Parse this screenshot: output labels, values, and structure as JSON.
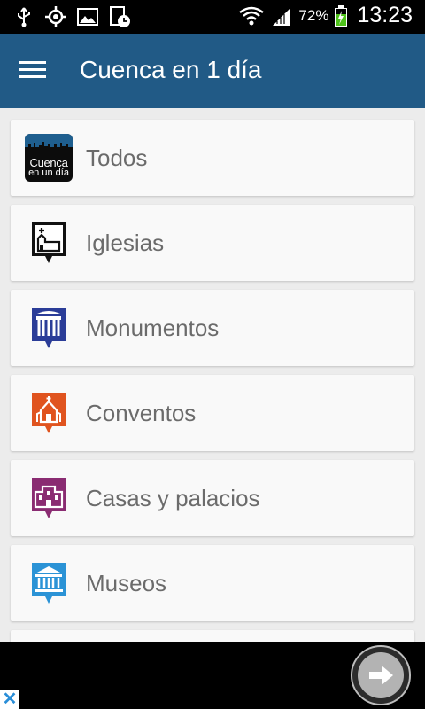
{
  "status_bar": {
    "battery_percent": "72%",
    "time": "13:23",
    "icons": [
      "usb-icon",
      "gps-icon",
      "image-icon",
      "clock-icon",
      "wifi-icon",
      "signal-icon",
      "battery-charging-icon"
    ]
  },
  "app_bar": {
    "title": "Cuenca en 1 día",
    "background_color": "#215a86",
    "menu_icon": "hamburger-icon"
  },
  "categories": [
    {
      "label": "Todos",
      "icon": "cuenca-logo-icon"
    },
    {
      "label": "Iglesias",
      "icon": "church-icon",
      "color": "#111111"
    },
    {
      "label": "Monumentos",
      "icon": "monument-icon",
      "color": "#2b3d98"
    },
    {
      "label": "Conventos",
      "icon": "convent-icon",
      "color": "#e0541f"
    },
    {
      "label": "Casas y palacios",
      "icon": "palace-icon",
      "color": "#8a2c72"
    },
    {
      "label": "Museos",
      "icon": "museum-icon",
      "color": "#2b93d6"
    }
  ],
  "logo": {
    "line1": "Cuenca",
    "line2": "en un día"
  },
  "ad_bar": {
    "close_icon": "close-icon",
    "arrow_icon": "arrow-right-icon"
  }
}
